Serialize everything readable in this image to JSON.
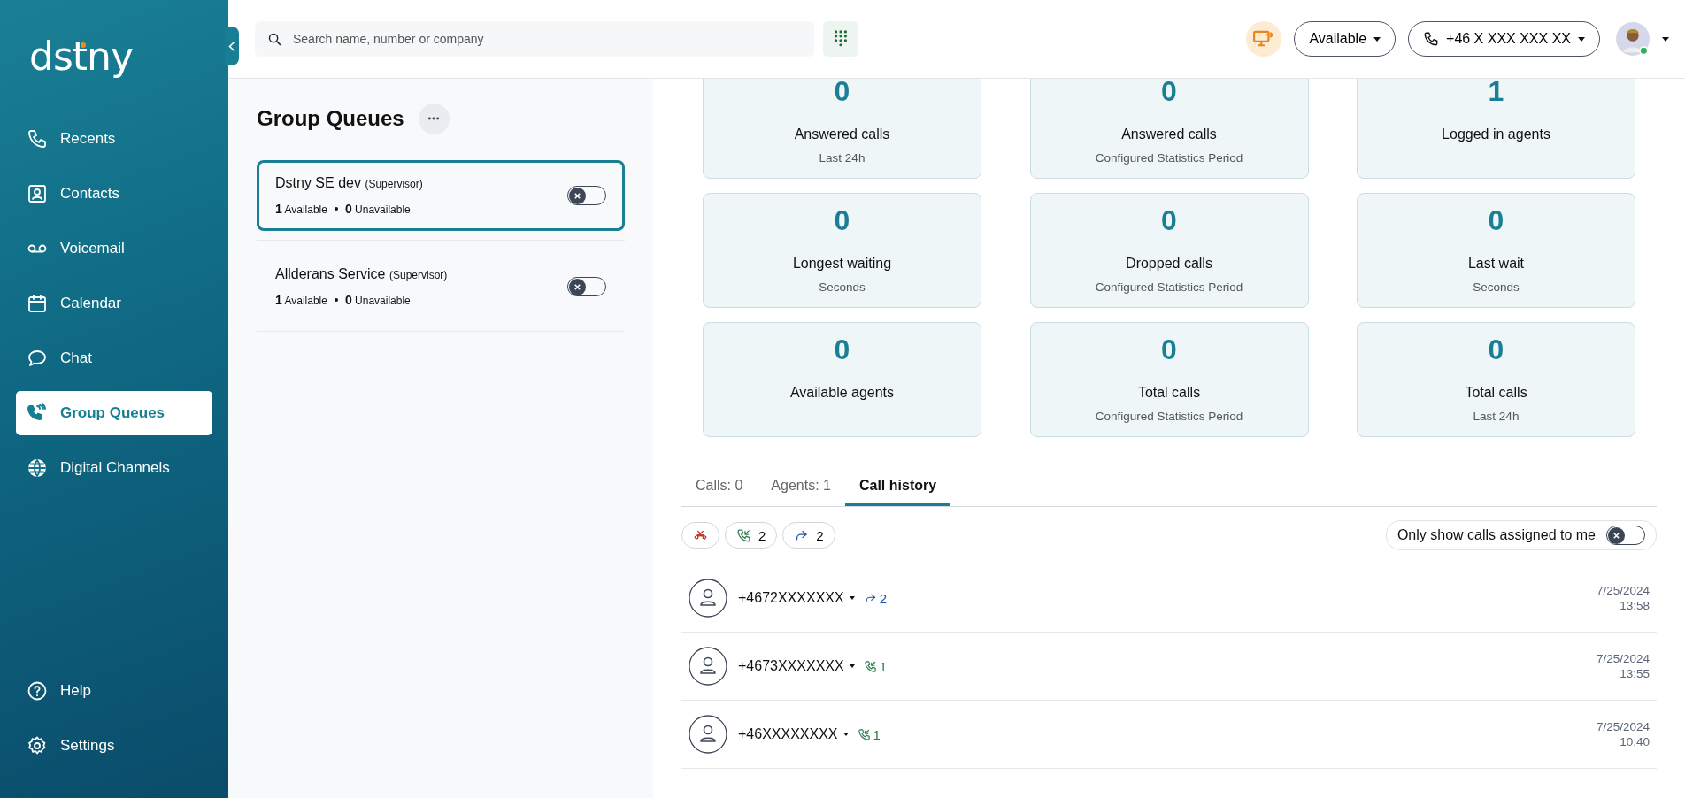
{
  "logo": "dstny",
  "sidebar": {
    "items": [
      {
        "label": "Recents",
        "selected": false
      },
      {
        "label": "Contacts",
        "selected": false
      },
      {
        "label": "Voicemail",
        "selected": false
      },
      {
        "label": "Calendar",
        "selected": false
      },
      {
        "label": "Chat",
        "selected": false
      },
      {
        "label": "Group Queues",
        "selected": true
      },
      {
        "label": "Digital Channels",
        "selected": false
      }
    ],
    "bottom_items": [
      {
        "label": "Help"
      },
      {
        "label": "Settings"
      }
    ]
  },
  "search": {
    "placeholder": "Search name, number or company"
  },
  "topbar": {
    "status": "Available",
    "phone": "+46 X XXX XXX XX"
  },
  "queues": {
    "title": "Group Queues",
    "items": [
      {
        "name": "Dstny SE dev",
        "role": "(Supervisor)",
        "available": "1",
        "available_label": "Available",
        "unavailable": "0",
        "unavailable_label": "Unavailable",
        "on": false,
        "selected": true
      },
      {
        "name": "Allderans Service",
        "role": "(Supervisor)",
        "available": "1",
        "available_label": "Available",
        "unavailable": "0",
        "unavailable_label": "Unavailable",
        "on": false,
        "selected": false
      }
    ]
  },
  "stats": [
    {
      "value": "0",
      "label": "Answered calls",
      "sublabel": "Last 24h"
    },
    {
      "value": "0",
      "label": "Answered calls",
      "sublabel": "Configured Statistics Period"
    },
    {
      "value": "1",
      "label": "Logged in agents"
    },
    {
      "value": "0",
      "label": "Longest waiting",
      "sublabel": "Seconds"
    },
    {
      "value": "0",
      "label": "Dropped calls",
      "sublabel": "Configured Statistics Period"
    },
    {
      "value": "0",
      "label": "Last wait",
      "sublabel": "Seconds"
    },
    {
      "value": "0",
      "label": "Available agents"
    },
    {
      "value": "0",
      "label": "Total calls",
      "sublabel": "Configured Statistics Period"
    },
    {
      "value": "0",
      "label": "Total calls",
      "sublabel": "Last 24h"
    }
  ],
  "tabs": [
    {
      "label": "Calls: 0",
      "selected": false
    },
    {
      "label": "Agents: 1",
      "selected": false
    },
    {
      "label": "Call history",
      "selected": true
    }
  ],
  "filters": [
    {
      "kind": "missed"
    },
    {
      "kind": "incoming",
      "count": "2"
    },
    {
      "kind": "forwarded",
      "count": "2"
    }
  ],
  "assigned_toggle": {
    "label": "Only show calls assigned to me",
    "on": false
  },
  "calls": [
    {
      "number": "+4672XXXXXXX",
      "kind": "forwarded",
      "count": "2",
      "date": "7/25/2024",
      "time": "13:58"
    },
    {
      "number": "+4673XXXXXXX",
      "kind": "incoming",
      "count": "1",
      "date": "7/25/2024",
      "time": "13:55"
    },
    {
      "number": "+46XXXXXXXX",
      "kind": "incoming",
      "count": "1",
      "date": "7/25/2024",
      "time": "10:40"
    }
  ]
}
